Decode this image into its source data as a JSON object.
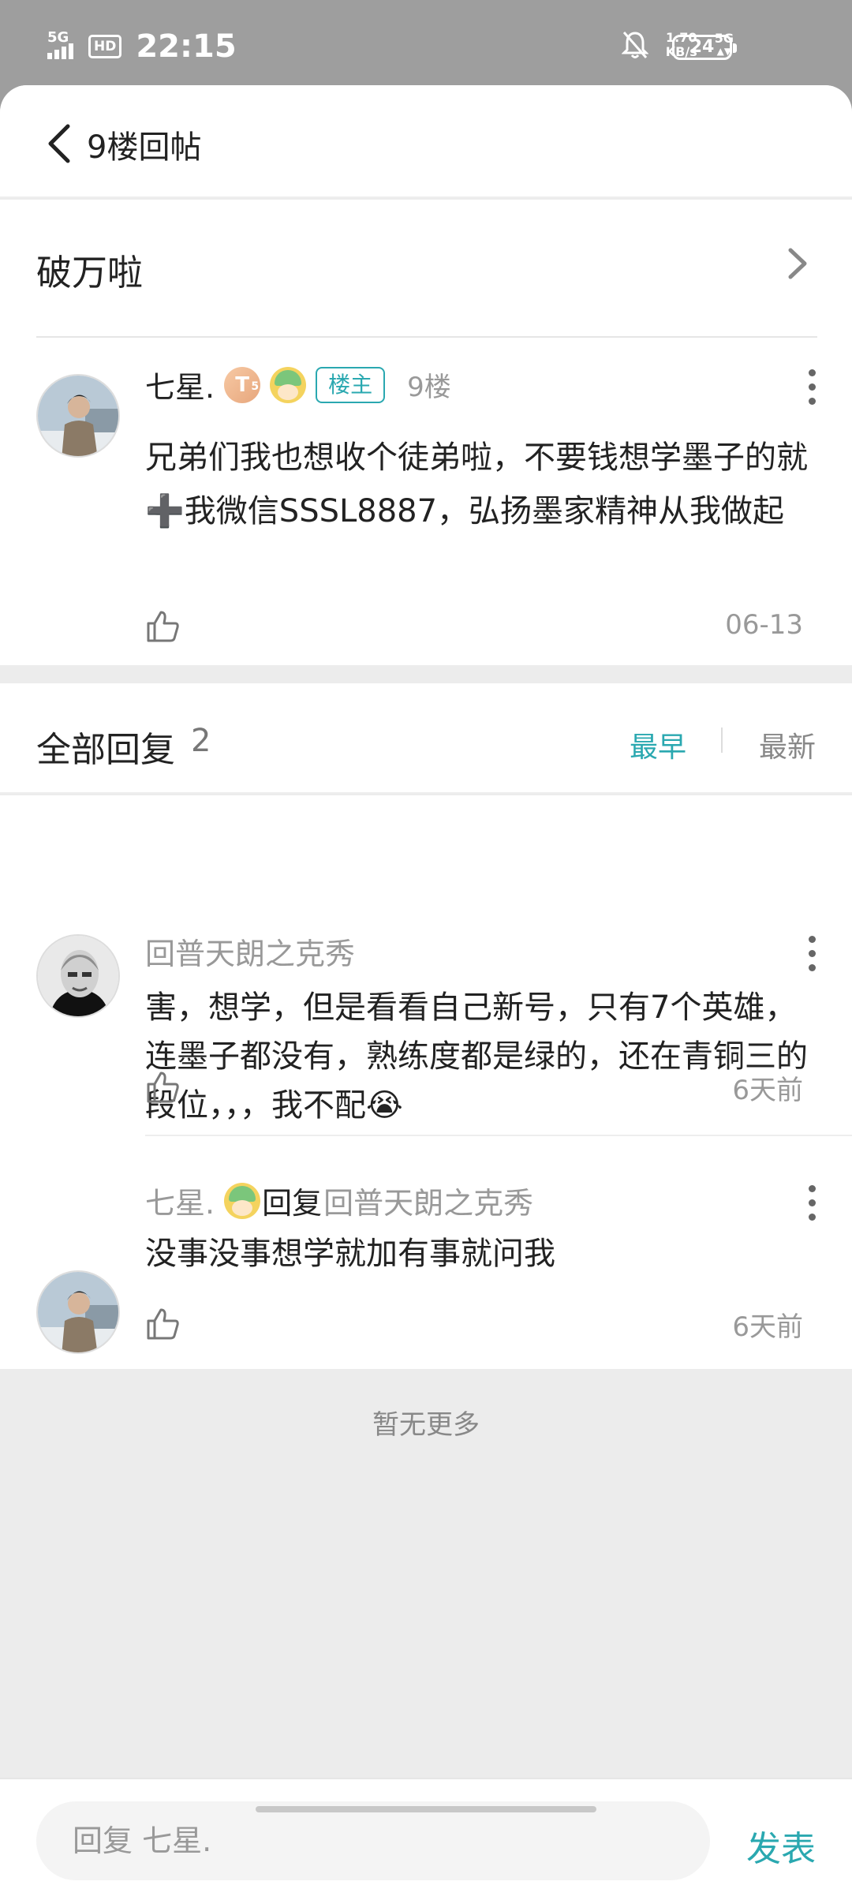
{
  "status_bar": {
    "network": "5G",
    "hd": "HD",
    "time": "22:15",
    "speed_value": "1.70",
    "speed_unit": "KB/s",
    "network_right": "5G",
    "battery": "24"
  },
  "header": {
    "back_icon": "chevron-left-icon",
    "title": "9楼回帖"
  },
  "thread": {
    "title": "破万啦",
    "chevron_icon": "chevron-right-icon"
  },
  "post": {
    "username": "七星.",
    "level": "T",
    "level_sub": "5",
    "owner_tag": "楼主",
    "floor": "9楼",
    "content": "兄弟们我也想收个徒弟啦，不要钱想学墨子的就➕我微信SSSL8887，弘扬墨家精神从我做起",
    "date": "06-13"
  },
  "replies_header": {
    "title": "全部回复",
    "count": "2",
    "sort_earliest": "最早",
    "sort_latest": "最新"
  },
  "replies": [
    {
      "username": "回普天朗之克秀",
      "content": "害，想学，但是看看自己新号，只有7个英雄，连墨子都没有，熟练度都是绿的，还在青铜三的段位，，，我不配😭",
      "time": "6天前"
    },
    {
      "username": "七星.",
      "reply_word": "回复",
      "reply_target": "回普天朗之克秀",
      "content": "没事没事想学就加有事就问我",
      "time": "6天前"
    }
  ],
  "footer_note": "暂无更多",
  "bottom_bar": {
    "input_placeholder": "回复 七星.",
    "publish_label": "发表"
  },
  "colors": {
    "accent": "#2aa8b0",
    "status_bar_bg": "#9e9e9e",
    "page_bg": "#ececec"
  }
}
